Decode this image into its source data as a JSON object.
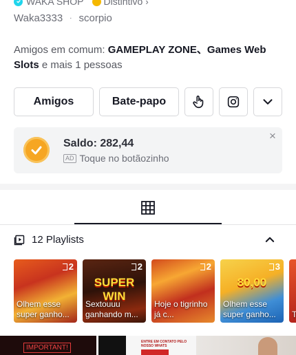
{
  "header": {
    "shop_label": "WAKA SHOP",
    "badge_label": "Distintivo",
    "username": "Waka3333",
    "separator": "·",
    "sign": "scorpio"
  },
  "mutual_friends": {
    "prefix": "Amigos em comum: ",
    "names": "GAMEPLAY ZONE、Games Web Slots",
    "suffix": " e mais 1 pessoas"
  },
  "actions": {
    "friends_label": "Amigos",
    "chat_label": "Bate-papo",
    "icons": [
      "hand-tap-icon",
      "instagram-icon",
      "chevron-down-icon"
    ]
  },
  "wallet": {
    "balance_text": "Saldo: 282,44",
    "ad_tag": "AD",
    "ad_text": "Toque no botãozinho",
    "close_symbol": "×",
    "accent": "#f6a623"
  },
  "tabs": {
    "active": "grid-icon"
  },
  "playlists": {
    "title": "12 Playlists",
    "items": [
      {
        "count": "2",
        "caption": "Olhem esse super ganho..."
      },
      {
        "count": "2",
        "caption": "Sextouuu ganhando m...",
        "art_text": "SUPER WIN"
      },
      {
        "count": "2",
        "caption": "Hoje o tigrinho já c..."
      },
      {
        "count": "3",
        "caption": "Olhem esse super ganho...",
        "art_text": "80,00"
      },
      {
        "count": "",
        "caption": "T"
      }
    ]
  },
  "bottom_strip": {
    "thumb1_text": "IMPORTANT!",
    "thumb2_text": "ENTRE EM CONTATO PELO NOSSO WHATS"
  }
}
